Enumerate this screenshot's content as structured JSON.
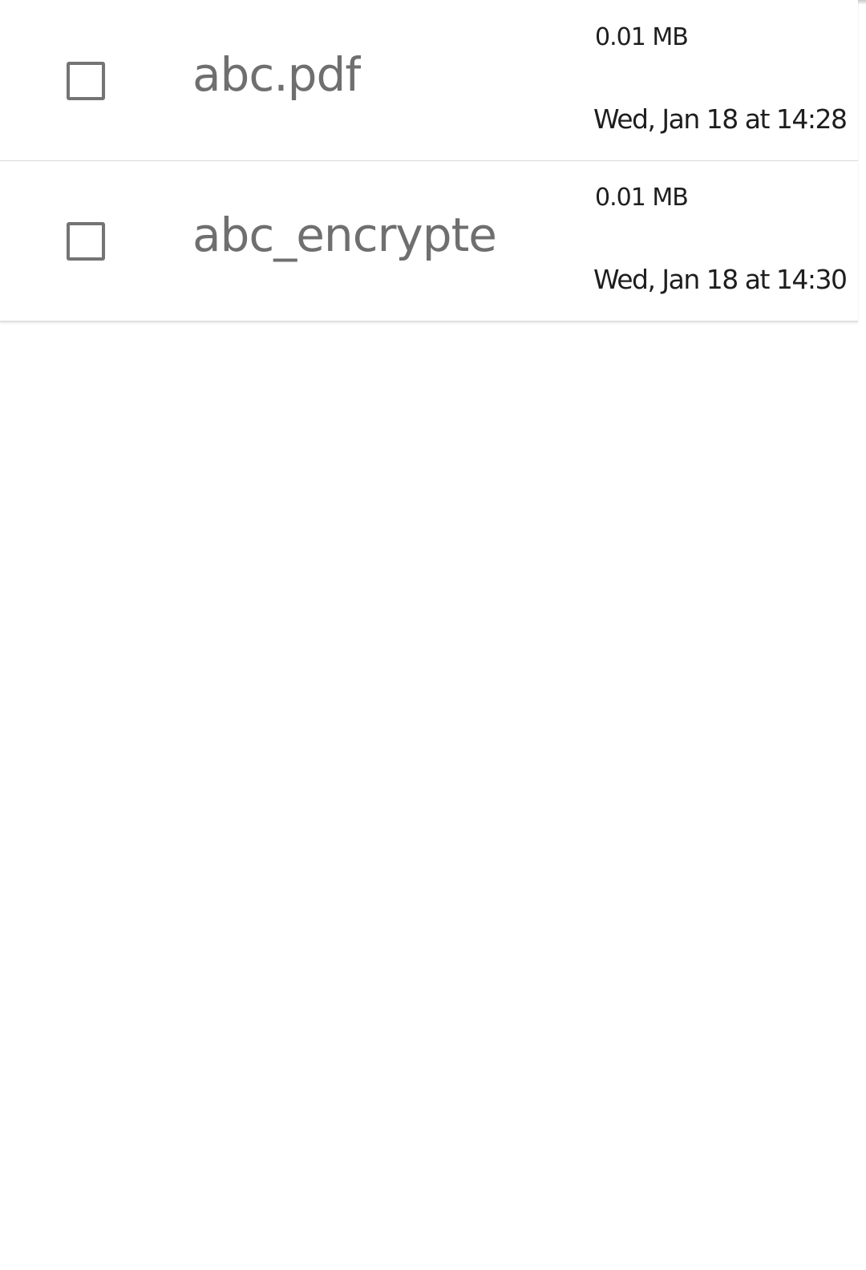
{
  "files": [
    {
      "name": "abc.pdf",
      "size": "0.01 MB",
      "modified": "Wed, Jan 18 at 14:28",
      "checked": false
    },
    {
      "name": "abc_encrypte",
      "size": "0.01 MB",
      "modified": "Wed, Jan 18 at 14:30",
      "checked": false
    }
  ],
  "colors": {
    "name_text": "#6f6f6f",
    "meta_text": "#1e1e1e",
    "checkbox_border": "#747474",
    "divider": "#d9d9d9"
  }
}
